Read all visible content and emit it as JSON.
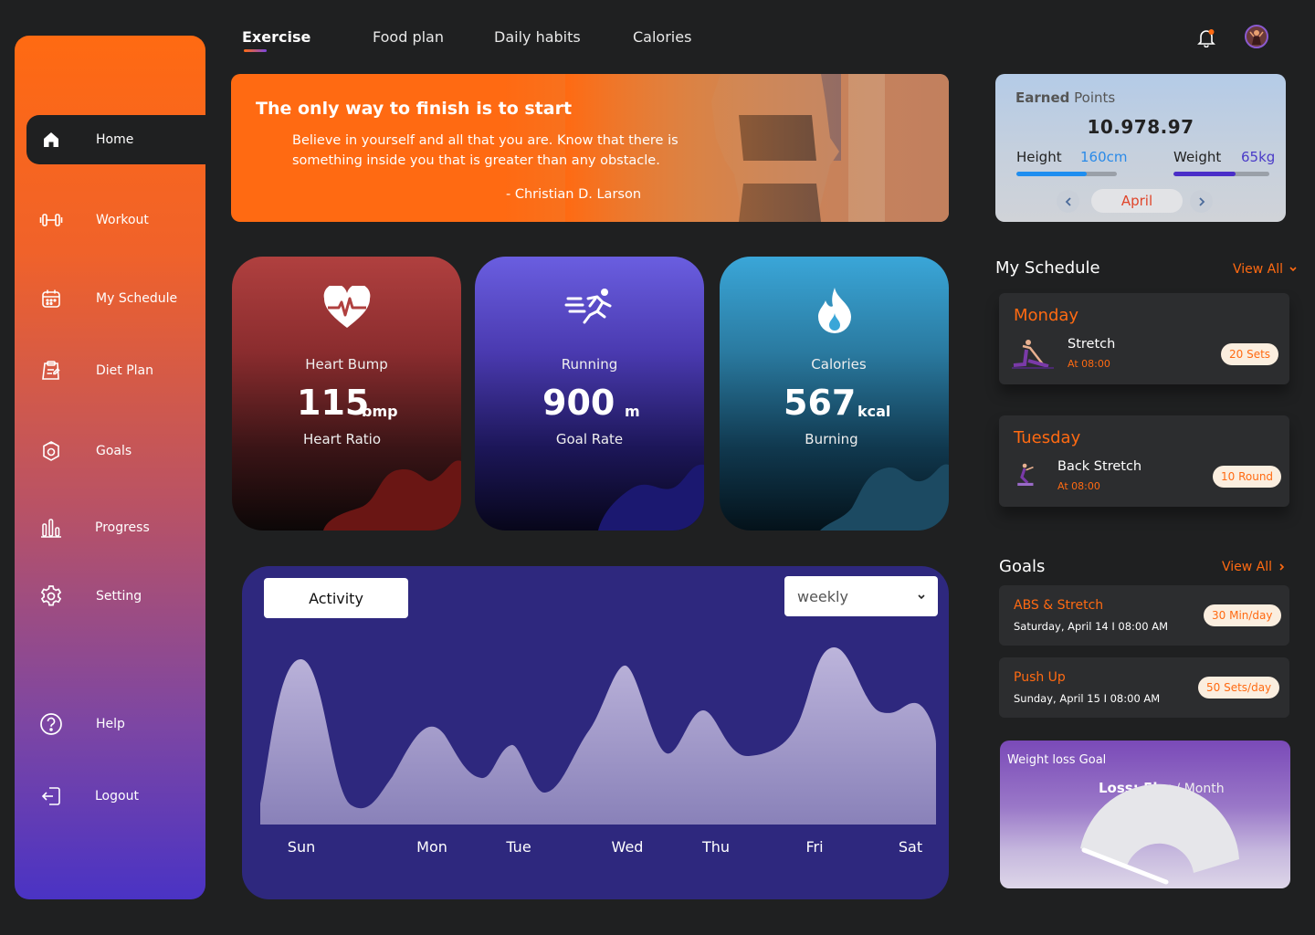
{
  "sidebar": {
    "items": [
      {
        "label": "Home",
        "icon": "home-icon"
      },
      {
        "label": "Workout",
        "icon": "dumbbell-icon"
      },
      {
        "label": "My Schedule",
        "icon": "calendar-icon"
      },
      {
        "label": "Diet Plan",
        "icon": "clipboard-icon"
      },
      {
        "label": "Goals",
        "icon": "goal-icon"
      },
      {
        "label": "Progress",
        "icon": "bar-chart-icon"
      },
      {
        "label": "Setting",
        "icon": "gear-icon"
      },
      {
        "label": "Help",
        "icon": "help-icon"
      },
      {
        "label": "Logout",
        "icon": "logout-icon"
      }
    ],
    "active": "Home"
  },
  "tabs": [
    "Exercise",
    "Food plan",
    "Daily habits",
    "Calories"
  ],
  "active_tab": "Exercise",
  "hero": {
    "title": "The only way to finish is to start",
    "quote": "Believe in yourself and all that you are. Know that there is something inside you that is greater than any obstacle.",
    "author": "- Christian D. Larson"
  },
  "stats": [
    {
      "label": "Heart Bump",
      "value": "115",
      "unit": "bmp",
      "sub": "Heart Ratio",
      "icon": "heart-pulse-icon"
    },
    {
      "label": "Running",
      "value": "900",
      "unit": "m",
      "sub": "Goal Rate",
      "icon": "running-icon"
    },
    {
      "label": "Calories",
      "value": "567",
      "unit": "kcal",
      "sub": "Burning",
      "icon": "flame-icon"
    }
  ],
  "activity": {
    "tab_label": "Activity",
    "period": "weekly",
    "days": [
      "Sun",
      "Mon",
      "Tue",
      "Wed",
      "Thu",
      "Fri",
      "Sat"
    ]
  },
  "points": {
    "title_bold": "Earned",
    "title_rest": " Points",
    "value": "10.978.97",
    "height_label": "Height",
    "height_value": "160cm",
    "height_fill": 0.7,
    "weight_label": "Weight",
    "weight_value": "65kg",
    "weight_fill": 0.65,
    "month": "April"
  },
  "schedule": {
    "title": "My Schedule",
    "view_all": "View All",
    "items": [
      {
        "day": "Monday",
        "name": "Stretch",
        "time": "At 08:00",
        "badge": "20 Sets"
      },
      {
        "day": "Tuesday",
        "name": "Back Stretch",
        "time": "At 08:00",
        "badge": "10 Round"
      }
    ]
  },
  "goals": {
    "title": "Goals",
    "view_all": "View All",
    "items": [
      {
        "name": "ABS & Stretch",
        "date": "Saturday, April 14 I 08:00 AM",
        "badge": "30 Min/day"
      },
      {
        "name": "Push Up",
        "date": "Sunday, April 15 I 08:00 AM",
        "badge": "50 Sets/day"
      }
    ]
  },
  "weight_loss": {
    "title": "Weight loss Goal",
    "loss_label": "Loss: 5kg",
    "per": " / Month"
  },
  "colors": {
    "accent": "#ff6a12",
    "heart_card": "#b0403f",
    "running_card": "#6a5ee0",
    "calories_card": "#3aa6d8",
    "activity_bg": "#2e287e"
  }
}
